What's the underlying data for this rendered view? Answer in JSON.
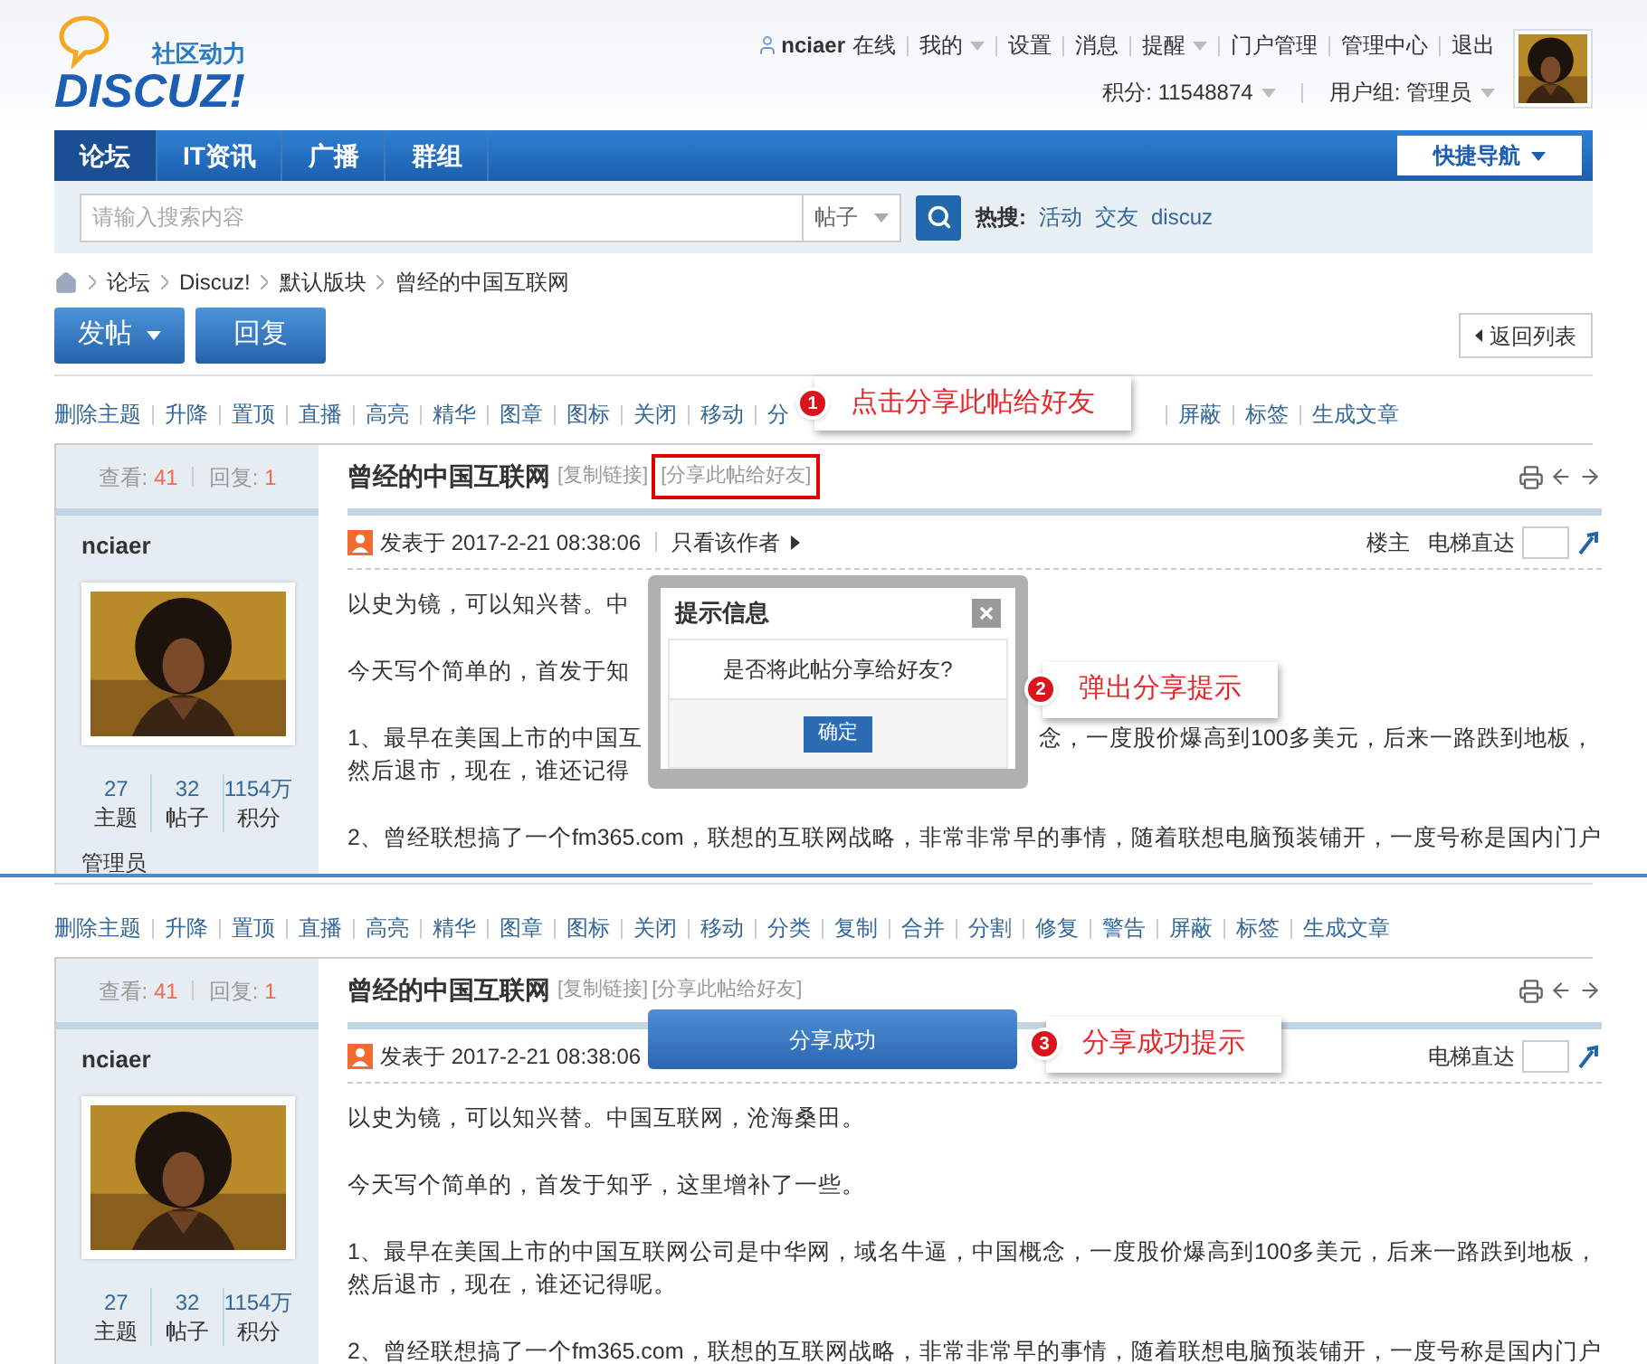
{
  "header": {
    "logo_tagline": "社区动力",
    "logo_text": "DISCUZ!",
    "user": "nciaer",
    "status": "在线",
    "menu": [
      {
        "label": "我的",
        "dropdown": true
      },
      {
        "label": "设置",
        "dropdown": false
      },
      {
        "label": "消息",
        "dropdown": false
      },
      {
        "label": "提醒",
        "dropdown": true
      },
      {
        "label": "门户管理",
        "dropdown": false
      },
      {
        "label": "管理中心",
        "dropdown": false
      },
      {
        "label": "退出",
        "dropdown": false
      }
    ],
    "points": "积分: 11548874",
    "group": "用户组: 管理员"
  },
  "nav": {
    "tabs": [
      {
        "label": "论坛",
        "selected": true
      },
      {
        "label": "IT资讯",
        "selected": false
      },
      {
        "label": "广播",
        "selected": false
      },
      {
        "label": "群组",
        "selected": false
      }
    ],
    "quick_nav": "快捷导航"
  },
  "search": {
    "placeholder": "请输入搜索内容",
    "scope": "帖子",
    "hot_label": "热搜:",
    "hot": [
      "活动",
      "交友",
      "discuz"
    ]
  },
  "breadcrumb": [
    "论坛",
    "Discuz!",
    "默认版块",
    "曾经的中国互联网"
  ],
  "buttons": {
    "new_post": "发帖",
    "reply": "回复",
    "back": "返回列表"
  },
  "panels": [
    {
      "mod_links_before": [
        "删除主题",
        "升降",
        "置顶",
        "直播",
        "高亮",
        "精华",
        "图章",
        "图标",
        "关闭",
        "移动",
        "分"
      ],
      "inline_callout": {
        "number": "1",
        "text": "点击分享此帖给好友"
      },
      "mod_links_after": [
        "屏蔽",
        "标签",
        "生成文章"
      ],
      "post": {
        "views_label": "查看:",
        "views": "41",
        "replies_label": "回复:",
        "replies": "1",
        "title": "曾经的中国互联网",
        "copy_link": "[复制链接]",
        "share_link": {
          "text": "[分享此帖给好友]",
          "highlighted": true
        },
        "author": "nciaer",
        "posted": "发表于 2017-2-21 08:38:06",
        "author_only": "只看该作者",
        "floor": "楼主",
        "jump_label": "电梯直达",
        "stats": [
          {
            "value": "27",
            "label": "主题"
          },
          {
            "value": "32",
            "label": "帖子"
          },
          {
            "value": "1154万",
            "label": "积分"
          }
        ],
        "role": "管理员",
        "paragraphs": [
          [
            {
              "text": "以史为镜，可以知兴替。中"
            }
          ],
          [
            {
              "text": "今天写个简单的，首发于知"
            }
          ],
          [
            {
              "text": "1、最早在美国上市的中国互",
              "after": "念，一度股价爆高到100多美元，后来一路跌到地板，"
            },
            {
              "text": "然后退市，现在，谁还记得"
            }
          ],
          [
            {
              "text": "2、曾经联想搞了一个fm365.com，联想的互联网战略，非常非常早的事情，随着联想电脑预装铺开，一度号称是国内门户"
            }
          ]
        ]
      },
      "dialog": {
        "title": "提示信息",
        "message": "是否将此帖分享给好友?",
        "confirm": "确定"
      },
      "callout": {
        "number": "2",
        "text": "弹出分享提示"
      }
    },
    {
      "mod_links_before": [
        "删除主题",
        "升降",
        "置顶",
        "直播",
        "高亮",
        "精华",
        "图章",
        "图标",
        "关闭",
        "移动",
        "分类",
        "复制",
        "合并",
        "分割",
        "修复",
        "警告",
        "屏蔽",
        "标签",
        "生成文章"
      ],
      "post": {
        "views_label": "查看:",
        "views": "41",
        "replies_label": "回复:",
        "replies": "1",
        "title": "曾经的中国互联网",
        "copy_link": "[复制链接]",
        "share_link": {
          "text": "[分享此帖给好友]",
          "highlighted": false
        },
        "author": "nciaer",
        "posted": "发表于 2017-2-21 08:38:06",
        "jump_label": "电梯直达",
        "stats": [
          {
            "value": "27",
            "label": "主题"
          },
          {
            "value": "32",
            "label": "帖子"
          },
          {
            "value": "1154万",
            "label": "积分"
          }
        ],
        "paragraphs": [
          [
            {
              "text": "以史为镜，可以知兴替。中国互联网，沧海桑田。"
            }
          ],
          [
            {
              "text": "今天写个简单的，首发于知乎，这里增补了一些。"
            }
          ],
          [
            {
              "text": "1、最早在美国上市的中国互联网公司是中华网，域名牛逼，中国概念，一度股价爆高到100多美元，后来一路跌到地板，"
            },
            {
              "text": "然后退市，现在，谁还记得呢。"
            }
          ],
          [
            {
              "text": "2、曾经联想搞了一个fm365.com，联想的互联网战略，非常非常早的事情，随着联想电脑预装铺开，一度号称是国内门户"
            }
          ]
        ]
      },
      "toast": "分享成功",
      "callout": {
        "number": "3",
        "text": "分享成功提示"
      }
    }
  ]
}
